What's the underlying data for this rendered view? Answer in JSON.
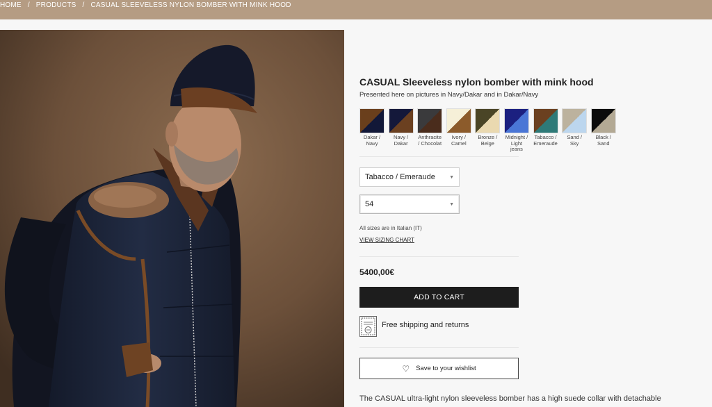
{
  "breadcrumb": {
    "items": [
      "HOME",
      "PRODUCTS",
      "CASUAL SLEEVELESS NYLON BOMBER WITH MINK HOOD"
    ],
    "separator": "/"
  },
  "product": {
    "title": "CASUAL Sleeveless nylon bomber with mink hood",
    "subtitle": "Presented here on pictures in Navy/Dakar and in Dakar/Navy",
    "swatches": [
      {
        "label": "Dakar / Navy",
        "color_a": "#6a3f1c",
        "color_b": "#121838"
      },
      {
        "label": "Navy / Dakar",
        "color_a": "#14183a",
        "color_b": "#6b4020"
      },
      {
        "label": "Anthracite / Chocolat",
        "color_a": "#3a3a3c",
        "color_b": "#4a2c1c"
      },
      {
        "label": "Ivory / Camel",
        "color_a": "#f6f0d8",
        "color_b": "#8c5b2b"
      },
      {
        "label": "Bronze / Beige",
        "color_a": "#4a4526",
        "color_b": "#ead9b0"
      },
      {
        "label": "Midnight / Light jeans",
        "color_a": "#1b2080",
        "color_b": "#4a76d6"
      },
      {
        "label": "Tabacco / Emeraude",
        "color_a": "#6b4020",
        "color_b": "#2e7a78"
      },
      {
        "label": "Sand / Sky",
        "color_a": "#bcb29e",
        "color_b": "#bcd6ee"
      },
      {
        "label": "Black / Sand",
        "color_a": "#0c0c0c",
        "color_b": "#b3a994"
      }
    ],
    "color_select": "Tabacco / Emeraude",
    "size_select": "54",
    "sizes_note": "All sizes are in Italian (IT)",
    "size_chart_link": "VIEW SIZING CHART",
    "price": "5400,00€",
    "add_to_cart": "ADD TO CART",
    "shipping": "Free shipping and returns",
    "wishlist": "Save to your wishlist",
    "description": "The CASUAL ultra-light nylon sleeveless bomber has a high suede collar with detachable"
  },
  "colors": {
    "breadcrumb_bg": "#b59c83",
    "button_dark": "#1d1d1d"
  },
  "icons": {
    "shipping": "stamp-icon",
    "wishlist": "heart-icon",
    "dropdown": "caret-down-icon"
  }
}
